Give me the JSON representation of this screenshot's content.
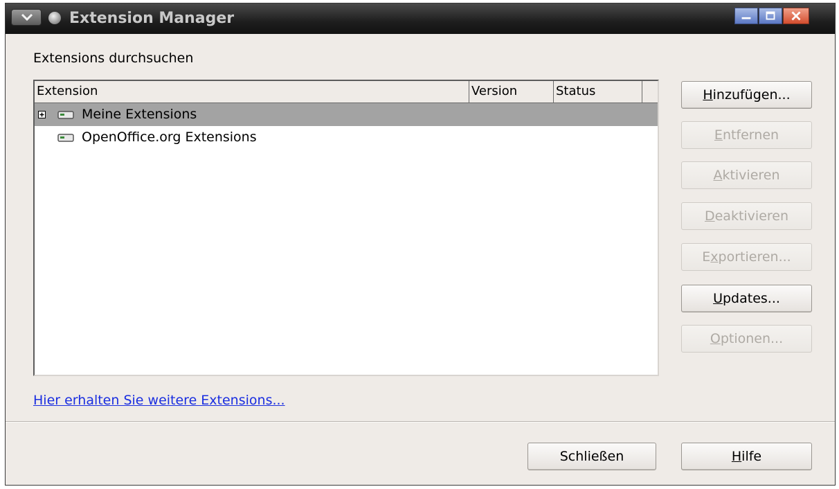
{
  "window": {
    "title": "Extension Manager"
  },
  "browse_label": "Extensions durchsuchen",
  "list": {
    "columns": [
      "Extension",
      "Version",
      "Status"
    ],
    "rows": [
      {
        "label": "Meine Extensions",
        "selected": true,
        "expandable": true
      },
      {
        "label": "OpenOffice.org Extensions",
        "selected": false,
        "expandable": false
      }
    ]
  },
  "buttons": {
    "add": {
      "pre": "",
      "key": "H",
      "post": "inzufügen...",
      "enabled": true
    },
    "remove": {
      "pre": "",
      "key": "E",
      "post": "ntfernen",
      "enabled": false
    },
    "enable": {
      "pre": "",
      "key": "A",
      "post": "ktivieren",
      "enabled": false
    },
    "disable": {
      "pre": "",
      "key": "D",
      "post": "eaktivieren",
      "enabled": false
    },
    "export": {
      "pre": "E",
      "key": "x",
      "post": "portieren...",
      "enabled": false
    },
    "updates": {
      "pre": "",
      "key": "U",
      "post": "pdates...",
      "enabled": true
    },
    "options": {
      "pre": "",
      "key": "O",
      "post": "ptionen...",
      "enabled": false
    },
    "close": {
      "label": "Schließen",
      "enabled": true
    },
    "help": {
      "pre": "",
      "key": "H",
      "post": "ilfe",
      "enabled": true
    }
  },
  "more_link": "Hier erhalten Sie weitere Extensions...",
  "colors": {
    "link": "#1a2ee0",
    "selection": "#a3a3a3",
    "dialog_bg": "#efebe7"
  },
  "icons": [
    "menu-icon",
    "app-icon",
    "minimize-icon",
    "maximize-icon",
    "close-icon",
    "expander-plus-icon",
    "package-icon"
  ]
}
